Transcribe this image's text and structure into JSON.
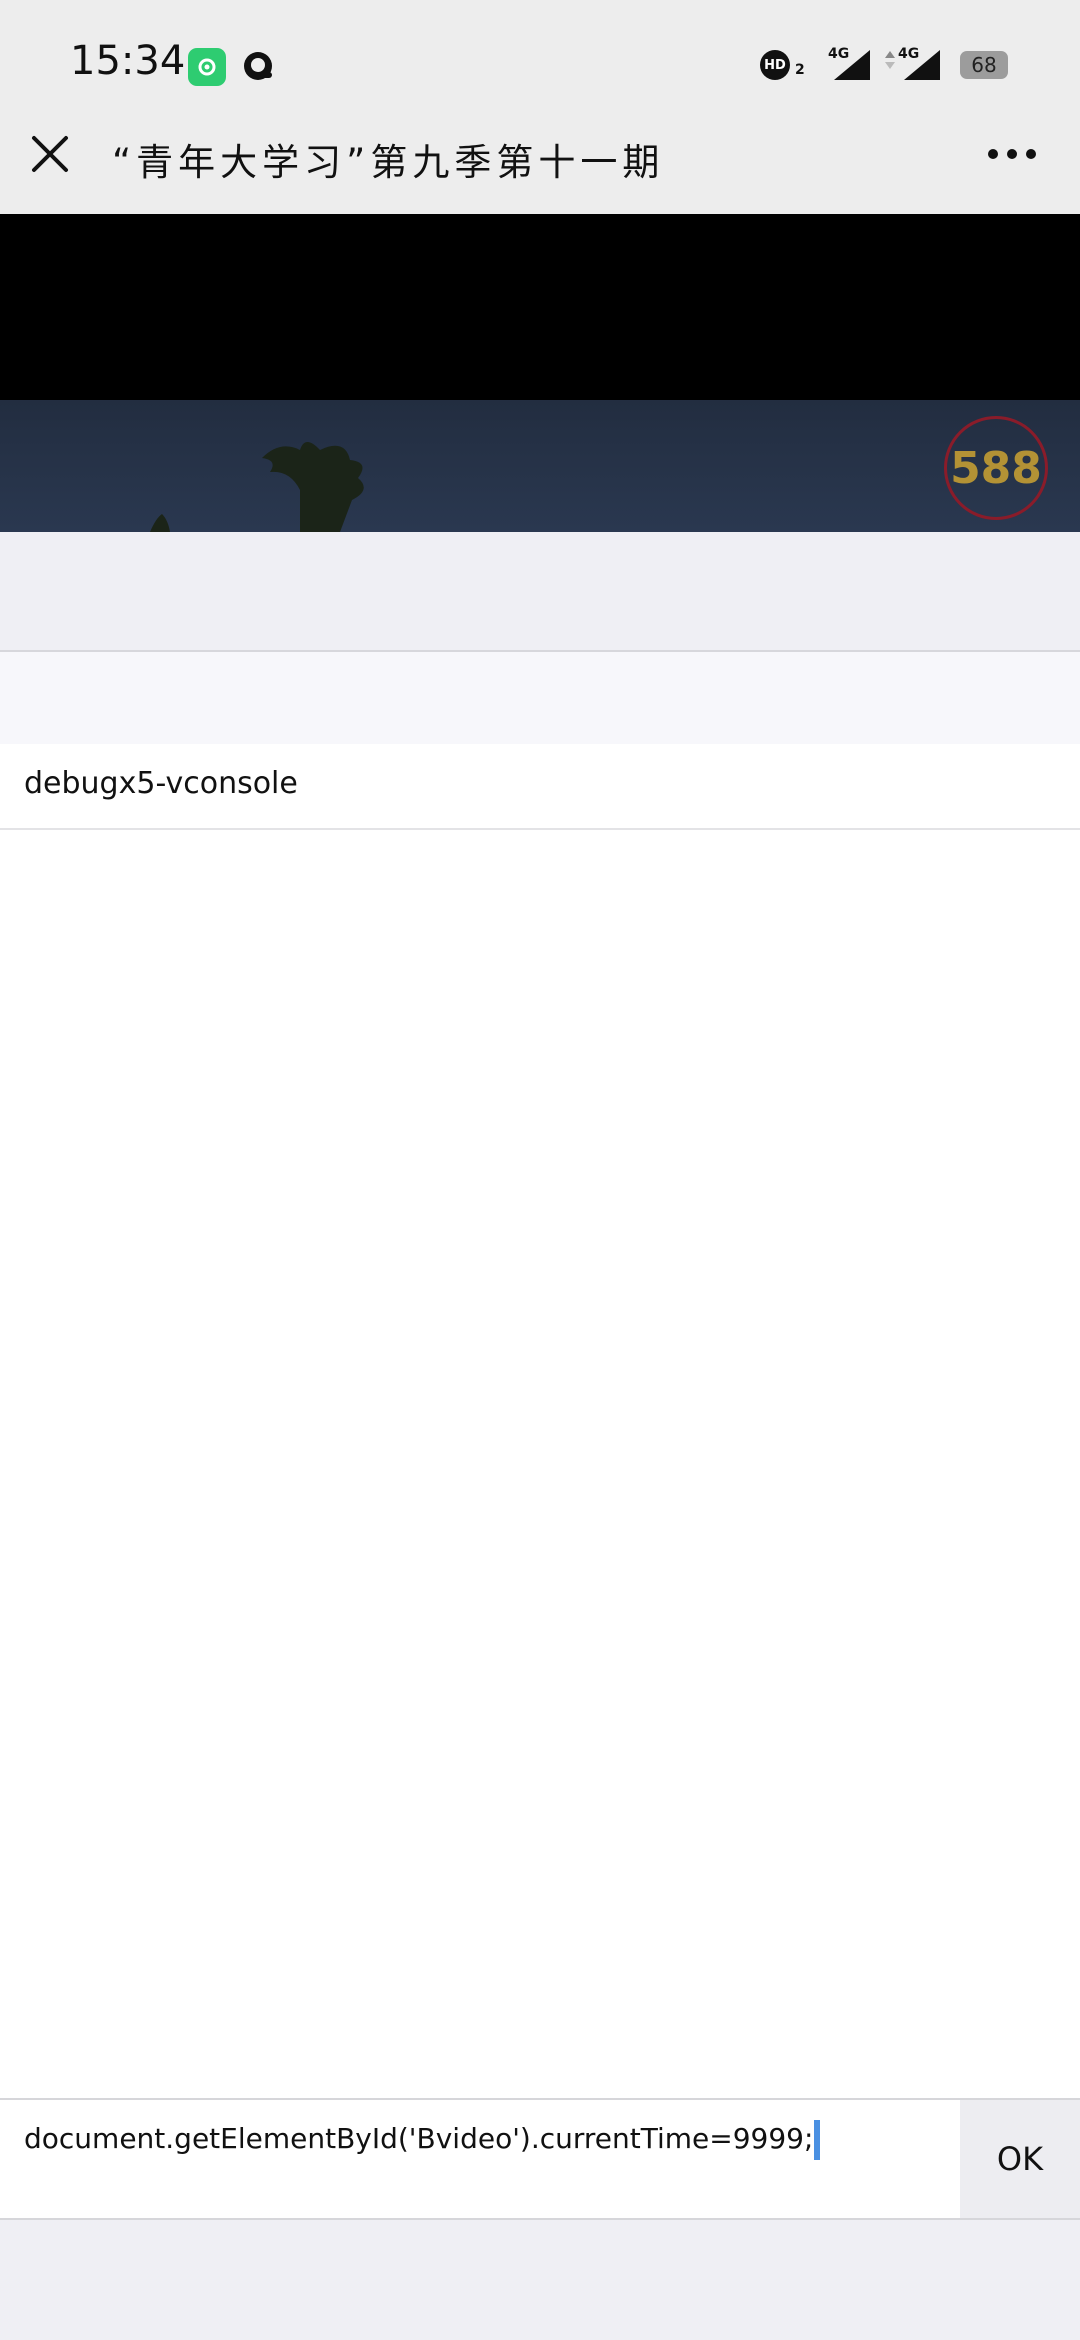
{
  "status_bar": {
    "time": "15:34",
    "hd_label": "HD",
    "hd_sub": "2",
    "network_1": "4G",
    "network_2": "4G",
    "battery": "68"
  },
  "header": {
    "title": "“青年大学习”第九季第十一期",
    "close_icon": "close-icon",
    "more_icon": "more-icon"
  },
  "video": {
    "badge_number": "588"
  },
  "console": {
    "item_label": "debugx5-vconsole"
  },
  "command": {
    "input_value": "document.getElementById('Bvideo').currentTime=9999;",
    "ok_label": "OK"
  },
  "colors": {
    "cursor": "#4a90e2",
    "status_app_green": "#2ecc71",
    "video_bg": "#253247",
    "badge_ring": "#8a1c2a",
    "badge_text": "#b39235"
  }
}
